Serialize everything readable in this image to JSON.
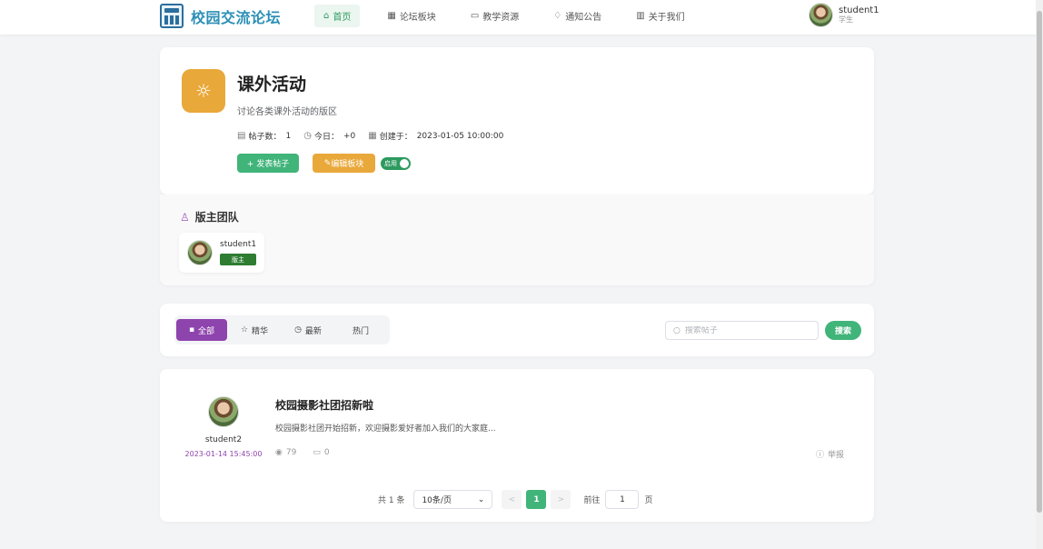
{
  "header": {
    "logo_text": "校园交流论坛",
    "nav": [
      {
        "label": "首页",
        "icon": "home-icon"
      },
      {
        "label": "论坛板块",
        "icon": "grid-icon"
      },
      {
        "label": "教学资源",
        "icon": "briefcase-icon"
      },
      {
        "label": "通知公告",
        "icon": "bell-icon"
      },
      {
        "label": "关于我们",
        "icon": "building-icon"
      }
    ],
    "user": {
      "name": "student1",
      "role": "学生"
    }
  },
  "board": {
    "icon": "sun-icon",
    "title": "课外活动",
    "description": "讨论各类课外活动的版区",
    "posts_label": "帖子数：",
    "posts_value": "1",
    "today_label": "今日：",
    "today_value": "+0",
    "created_label": "创建于：",
    "created_value": "2023-01-05 10:00:00",
    "post_button": "+ 发表帖子",
    "edit_button": "编辑板块",
    "toggle_label": "启用",
    "toggle_on": true,
    "accent_color": "#e9a83a"
  },
  "team": {
    "title": "版主团队",
    "moderators": [
      {
        "name": "student1",
        "badge": "版主"
      }
    ]
  },
  "filter": {
    "tabs": [
      {
        "label": "全部",
        "icon": "grid-icon"
      },
      {
        "label": "精华",
        "icon": "star-icon"
      },
      {
        "label": "最新",
        "icon": "clock-icon"
      },
      {
        "label": "热门",
        "icon": ""
      }
    ],
    "active_tab": "全部",
    "search_placeholder": "搜索帖子",
    "search_button": "搜索"
  },
  "posts": [
    {
      "author": "student2",
      "time": "2023-01-14 15:45:00",
      "title": "校园摄影社团招新啦",
      "excerpt": "校园摄影社团开始招新，欢迎摄影爱好者加入我们的大家庭...",
      "views": "79",
      "comments": "0",
      "report": "举报"
    }
  ],
  "pagination": {
    "total": "共 1 条",
    "page_size": "10条/页",
    "prev": "<",
    "current_page": "1",
    "next": ">",
    "goto_label": "前往",
    "goto_value": "1",
    "page_suffix": "页"
  },
  "colors": {
    "primary_green": "#41b47a",
    "purple": "#8e44ad",
    "orange": "#e9a83a"
  }
}
